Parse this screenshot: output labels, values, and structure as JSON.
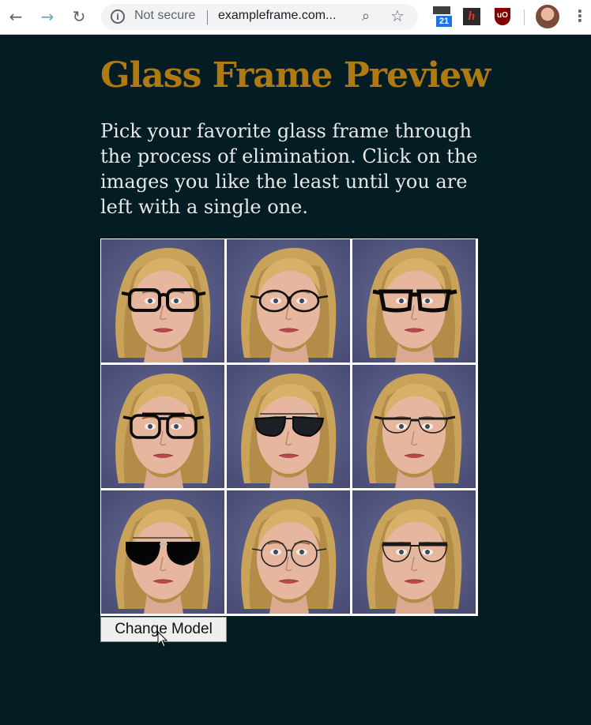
{
  "browser": {
    "security_label": "Not secure",
    "url": "exampleframe.com...",
    "info_icon": "i",
    "calendar_badge": "21",
    "ext_h_label": "h",
    "ext_ublock_label": "uO",
    "menu": "⋮"
  },
  "page": {
    "title": "Glass Frame Preview",
    "intro": "Pick your favorite glass frame through the process of elimination. Click on the images you like the least until you are left with a single one.",
    "button_label": "Change Model"
  },
  "frames": [
    {
      "style": "thick-rect"
    },
    {
      "style": "thin-round"
    },
    {
      "style": "thick-square"
    },
    {
      "style": "double-bridge"
    },
    {
      "style": "dark-sunglasses"
    },
    {
      "style": "half-rim"
    },
    {
      "style": "aviator-sunglasses"
    },
    {
      "style": "wire-round"
    },
    {
      "style": "browline"
    }
  ],
  "colors": {
    "background": "#041d24",
    "title": "#b07a12",
    "intro_text": "#e7e7e7"
  }
}
